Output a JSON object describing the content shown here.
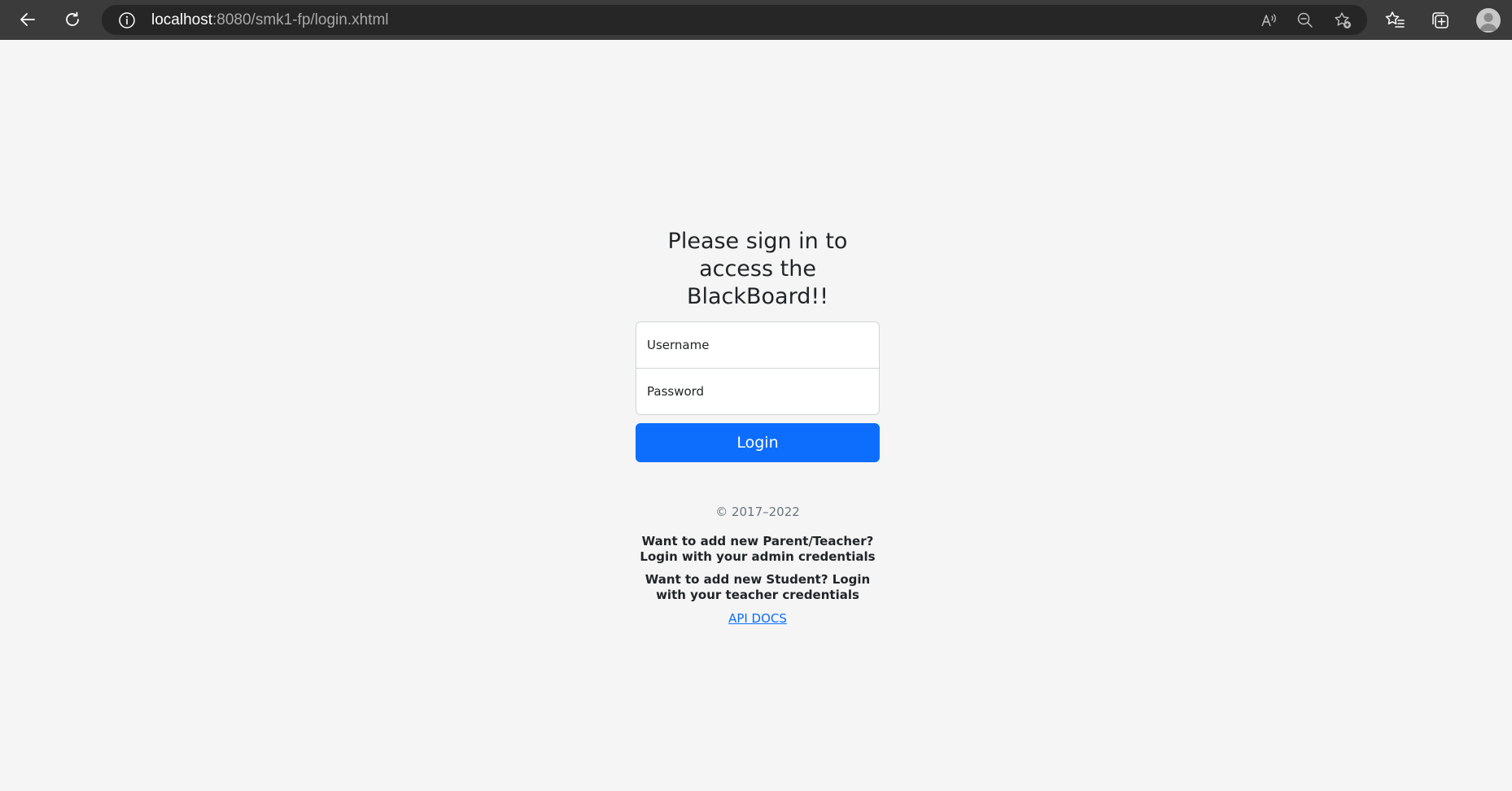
{
  "browser": {
    "url_host": "localhost",
    "url_rest": ":8080/smk1-fp/login.xhtml",
    "icons": [
      "back-arrow-icon",
      "refresh-icon",
      "info-icon",
      "read-aloud-icon",
      "zoom-out-icon",
      "add-favorite-icon",
      "favorites-icon",
      "collections-icon",
      "profile-icon"
    ]
  },
  "form": {
    "title": "Please sign in to access the BlackBoard!!",
    "username_placeholder": "Username",
    "password_placeholder": "Password",
    "login_label": "Login"
  },
  "footer": {
    "copyright": "© 2017–2022",
    "note_parent_teacher": "Want to add new Parent/Teacher? Login with your admin credentials",
    "note_student": "Want to add new Student? Login with your teacher credentials",
    "api_docs_label": "API DOCS"
  },
  "colors": {
    "primary": "#0d6efd",
    "page_background": "#f5f5f5",
    "browser_bar": "#3b3b3b"
  }
}
